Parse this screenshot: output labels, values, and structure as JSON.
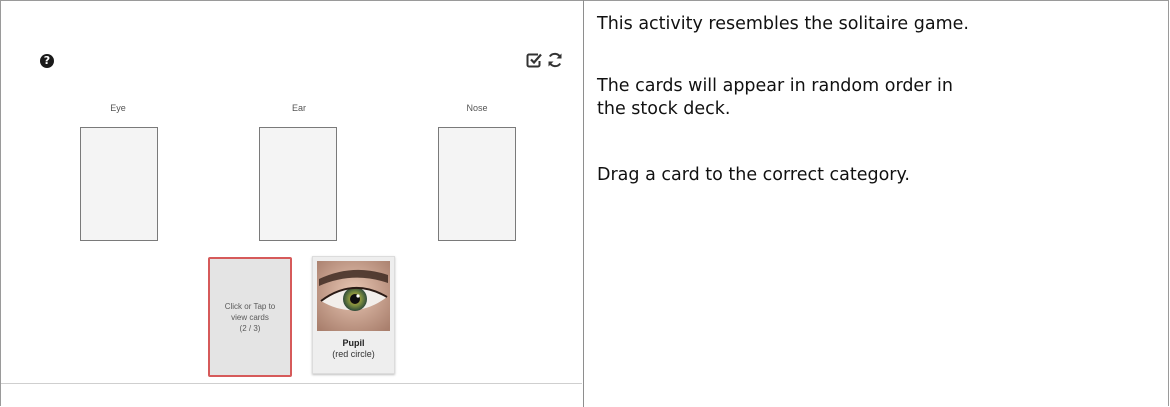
{
  "activity": {
    "help_icon": "question-circle-icon",
    "check_icon": "check-square-icon",
    "reset_icon": "refresh-icon",
    "categories": [
      {
        "label": "Eye"
      },
      {
        "label": "Ear"
      },
      {
        "label": "Nose"
      }
    ],
    "stock": {
      "text": "Click or Tap to\nview cards\n(2 / 3)"
    },
    "card": {
      "title": "Pupil",
      "subtitle": "(red circle)",
      "image_icon": "eye-photo"
    },
    "accent_color": "#d65a5a"
  },
  "instructions": {
    "p1": "This activity resembles the solitaire game.",
    "p2_line1": "The cards will appear in random order in",
    "p2_line2": "the stock deck.",
    "p3": "Drag a card to the correct category."
  }
}
